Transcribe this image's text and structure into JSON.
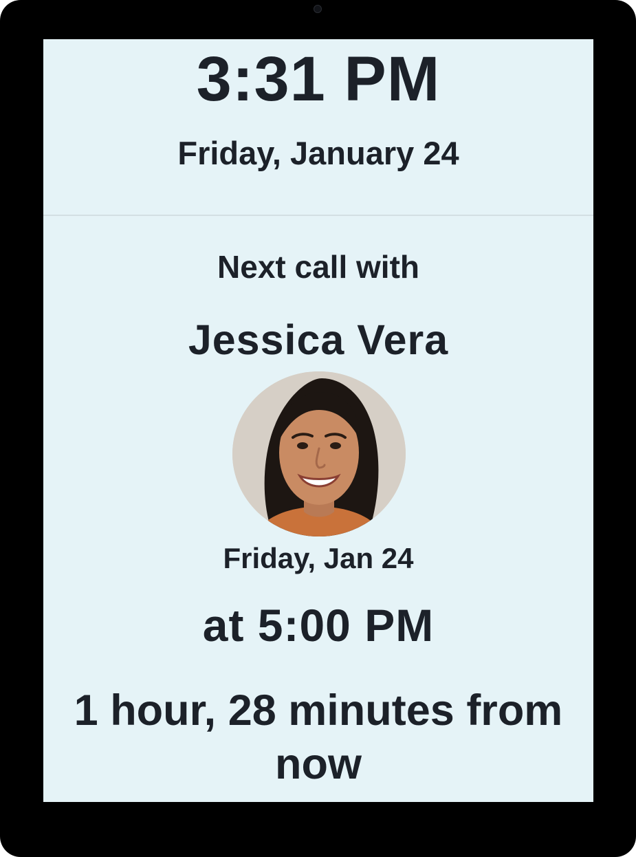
{
  "clock": {
    "time": "3:31 PM",
    "date": "Friday, January 24"
  },
  "next_call": {
    "intro": "Next call with",
    "contact_name": "Jessica Vera",
    "date": "Friday, Jan 24",
    "time": "at 5:00 PM",
    "countdown": "1 hour, 28 minutes from now"
  },
  "colors": {
    "screen_background": "#e5f3f7",
    "text": "#1c2129",
    "device_frame": "#000000",
    "divider": "#d3dfe3"
  },
  "icons": {
    "avatar": "contact-photo"
  }
}
